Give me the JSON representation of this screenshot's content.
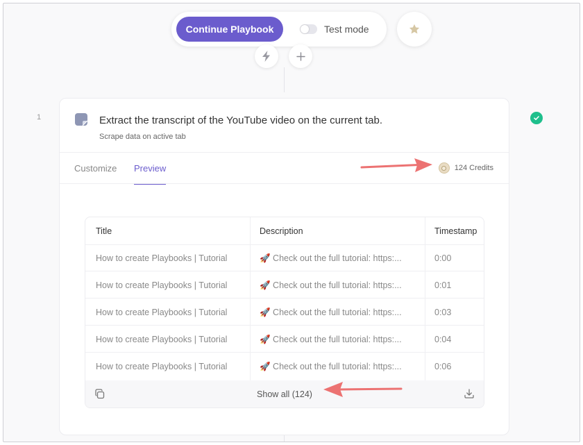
{
  "toolbar": {
    "continue_label": "Continue Playbook",
    "test_mode_label": "Test mode"
  },
  "step": {
    "number": "1",
    "title": "Extract the transcript of the YouTube video on the current tab.",
    "subtitle": "Scrape data on active tab",
    "tabs": [
      {
        "label": "Customize",
        "active": false
      },
      {
        "label": "Preview",
        "active": true
      }
    ],
    "credits": "124 Credits"
  },
  "table": {
    "columns": [
      "Title",
      "Description",
      "Timestamp"
    ],
    "rows": [
      {
        "title": "How to create Playbooks | Tutorial",
        "description": "🚀 Check out the full tutorial: https:...",
        "timestamp": "0:00"
      },
      {
        "title": "How to create Playbooks | Tutorial",
        "description": "🚀 Check out the full tutorial: https:...",
        "timestamp": "0:01"
      },
      {
        "title": "How to create Playbooks | Tutorial",
        "description": "🚀 Check out the full tutorial: https:...",
        "timestamp": "0:03"
      },
      {
        "title": "How to create Playbooks | Tutorial",
        "description": "🚀 Check out the full tutorial: https:...",
        "timestamp": "0:04"
      },
      {
        "title": "How to create Playbooks | Tutorial",
        "description": "🚀 Check out the full tutorial: https:...",
        "timestamp": "0:06"
      }
    ],
    "show_all_label": "Show all (124)"
  },
  "colors": {
    "accent": "#6b5ccd",
    "success": "#1fbf8c",
    "annotation_arrow": "#ec7272"
  },
  "icons": [
    "star-icon",
    "lightning-icon",
    "plus-icon",
    "sticky-note-icon",
    "check-icon",
    "credit-coin-icon",
    "copy-icon",
    "download-icon"
  ]
}
